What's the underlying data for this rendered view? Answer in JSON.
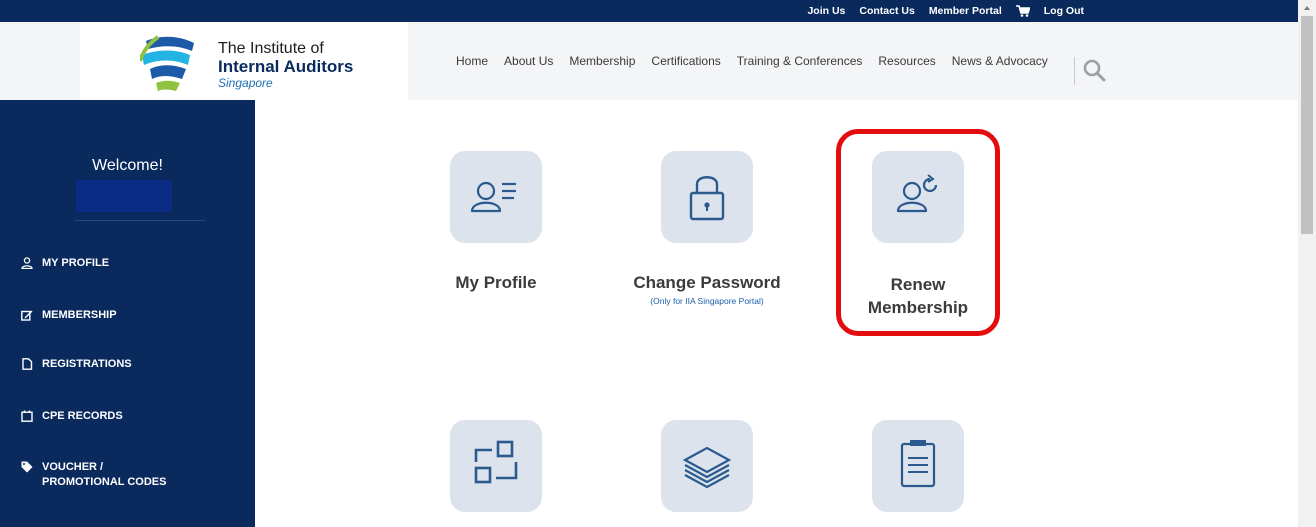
{
  "topbar": {
    "links": [
      "Join Us",
      "Contact Us",
      "Member Portal"
    ],
    "cart_icon": "cart-icon",
    "logout": "Log Out"
  },
  "logo": {
    "line1": "The Institute of",
    "line2": "Internal Auditors",
    "line3": "Singapore"
  },
  "nav": {
    "items": [
      "Home",
      "About Us",
      "Membership",
      "Certifications",
      "Training & Conferences",
      "Resources",
      "News & Advocacy"
    ],
    "search_icon": "search-icon"
  },
  "sidebar": {
    "welcome": "Welcome!",
    "items": [
      {
        "label": "MY PROFILE",
        "icon": "user-icon"
      },
      {
        "label": "MEMBERSHIP",
        "icon": "edit-icon"
      },
      {
        "label": "REGISTRATIONS",
        "icon": "document-icon"
      },
      {
        "label": "CPE RECORDS",
        "icon": "calendar-icon"
      },
      {
        "label": "VOUCHER /",
        "label2": "PROMOTIONAL CODES",
        "icon": "tag-icon"
      }
    ]
  },
  "tiles": [
    {
      "label": "My Profile",
      "icon": "profile-list-icon"
    },
    {
      "label": "Change Password",
      "sub": "(Only for IIA Singapore Portal)",
      "icon": "lock-icon"
    },
    {
      "label": "Renew",
      "label2": "Membership",
      "icon": "renew-user-icon"
    },
    {
      "icon": "squares-icon"
    },
    {
      "icon": "layers-icon"
    },
    {
      "icon": "clipboard-icon"
    }
  ],
  "colors": {
    "navy": "#0a2a5e",
    "tile_bg": "#dde3ec",
    "highlight": "#e30d0d",
    "icon_blue": "#2b5a8f"
  }
}
